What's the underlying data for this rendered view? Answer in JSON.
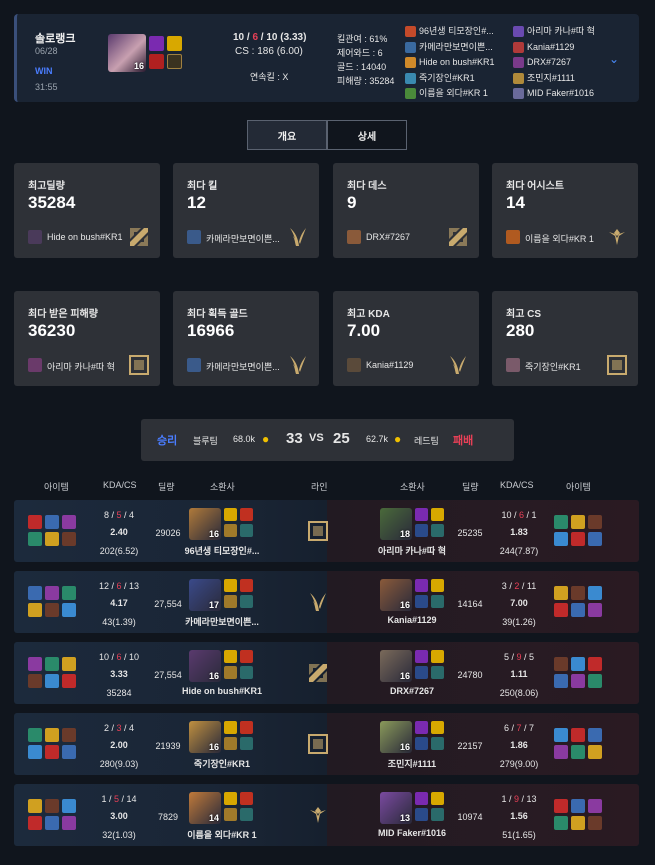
{
  "summary": {
    "queue": "솔로랭크",
    "date": "06/28",
    "result": "WIN",
    "duration": "31:55",
    "champ_level": "16",
    "kda_k": "10",
    "kda_d": "6",
    "kda_a": "10",
    "kda_ratio": "(3.33)",
    "cs": "CS : 186 (6.00)",
    "streak": "연속킬 :  X",
    "kill_part": "킬관여 : 61%",
    "control_wards": "제어와드 : 6",
    "gold": "골드 : 14040",
    "damage": "피해량 : 35284"
  },
  "team_list_left": [
    "96년생 티모장인#...",
    "카메라만보면이쁜...",
    "Hide on bush#KR1",
    "죽기장인#KR1",
    "이름을 외다#KR 1"
  ],
  "team_list_right": [
    "아리마 카나#따 혁",
    "Kania#1129",
    "DRX#7267",
    "조민지#1111",
    "MID Faker#1016"
  ],
  "tabs": [
    "개요",
    "상세"
  ],
  "cards": [
    {
      "title": "최고딜량",
      "value": "35284",
      "name": "Hide on bush#KR1"
    },
    {
      "title": "최다 킬",
      "value": "12",
      "name": "카메라만보면이쁜..."
    },
    {
      "title": "최다 데스",
      "value": "9",
      "name": "DRX#7267"
    },
    {
      "title": "최다 어시스트",
      "value": "14",
      "name": "이름을 외다#KR 1"
    },
    {
      "title": "최다 받은 피해량",
      "value": "36230",
      "name": "아리마 카나#따 혁"
    },
    {
      "title": "최다 획득 골드",
      "value": "16966",
      "name": "카메라만보면이쁜..."
    },
    {
      "title": "최고 KDA",
      "value": "7.00",
      "name": "Kania#1129"
    },
    {
      "title": "최고 CS",
      "value": "280",
      "name": "죽기장인#KR1"
    }
  ],
  "banner": {
    "win": "승리",
    "blue": "블루팀",
    "blue_gold": "68.0k",
    "blue_kills": "33",
    "vs": "VS",
    "red_kills": "25",
    "red_gold": "62.7k",
    "red": "레드팀",
    "lose": "패배"
  },
  "headers": {
    "items": "아이템",
    "kdacs": "KDA/CS",
    "dmg": "딜량",
    "champ": "소환사",
    "lane": "라인",
    "champ2": "소환사",
    "dmg2": "딜량",
    "kdacs2": "KDA/CS",
    "items2": "아이템"
  },
  "rows": [
    {
      "l": {
        "k": "8",
        "d": "5",
        "a": "4",
        "ratio": "2.40",
        "cs": "202(6.52)",
        "dmg": "29026",
        "name": "96년생 티모장인#...",
        "lv": "16"
      },
      "r": {
        "k": "10",
        "d": "6",
        "a": "1",
        "ratio": "1.83",
        "cs": "244(7.87)",
        "dmg": "25235",
        "name": "아리마 카나#따 혁",
        "lv": "18"
      }
    },
    {
      "l": {
        "k": "12",
        "d": "6",
        "a": "13",
        "ratio": "4.17",
        "cs": "43(1.39)",
        "dmg": "27,554",
        "name": "카메라만보면이쁜...",
        "lv": "17"
      },
      "r": {
        "k": "3",
        "d": "2",
        "a": "11",
        "ratio": "7.00",
        "cs": "39(1.26)",
        "dmg": "14164",
        "name": "Kania#1129",
        "lv": "16"
      }
    },
    {
      "l": {
        "k": "10",
        "d": "6",
        "a": "10",
        "ratio": "3.33",
        "cs": "35284",
        "dmg": "27,554",
        "name": "Hide on bush#KR1",
        "lv": "16"
      },
      "r": {
        "k": "5",
        "d": "9",
        "a": "5",
        "ratio": "1.11",
        "cs": "250(8.06)",
        "dmg": "24780",
        "name": "DRX#7267",
        "lv": "16"
      }
    },
    {
      "l": {
        "k": "2",
        "d": "3",
        "a": "4",
        "ratio": "2.00",
        "cs": "280(9.03)",
        "dmg": "21939",
        "name": "죽기장인#KR1",
        "lv": "16"
      },
      "r": {
        "k": "6",
        "d": "7",
        "a": "7",
        "ratio": "1.86",
        "cs": "279(9.00)",
        "dmg": "22157",
        "name": "조민지#1111",
        "lv": "16"
      }
    },
    {
      "l": {
        "k": "1",
        "d": "5",
        "a": "14",
        "ratio": "3.00",
        "cs": "32(1.03)",
        "dmg": "7829",
        "name": "이름을 외다#KR 1",
        "lv": "14"
      },
      "r": {
        "k": "1",
        "d": "9",
        "a": "13",
        "ratio": "1.56",
        "cs": "51(1.65)",
        "dmg": "10974",
        "name": "MID Faker#1016",
        "lv": "13"
      }
    }
  ],
  "colors": {
    "win": "#4a7dff",
    "lose": "#e84057",
    "gold": "#f0c000",
    "accent": "#c8aa6e"
  }
}
